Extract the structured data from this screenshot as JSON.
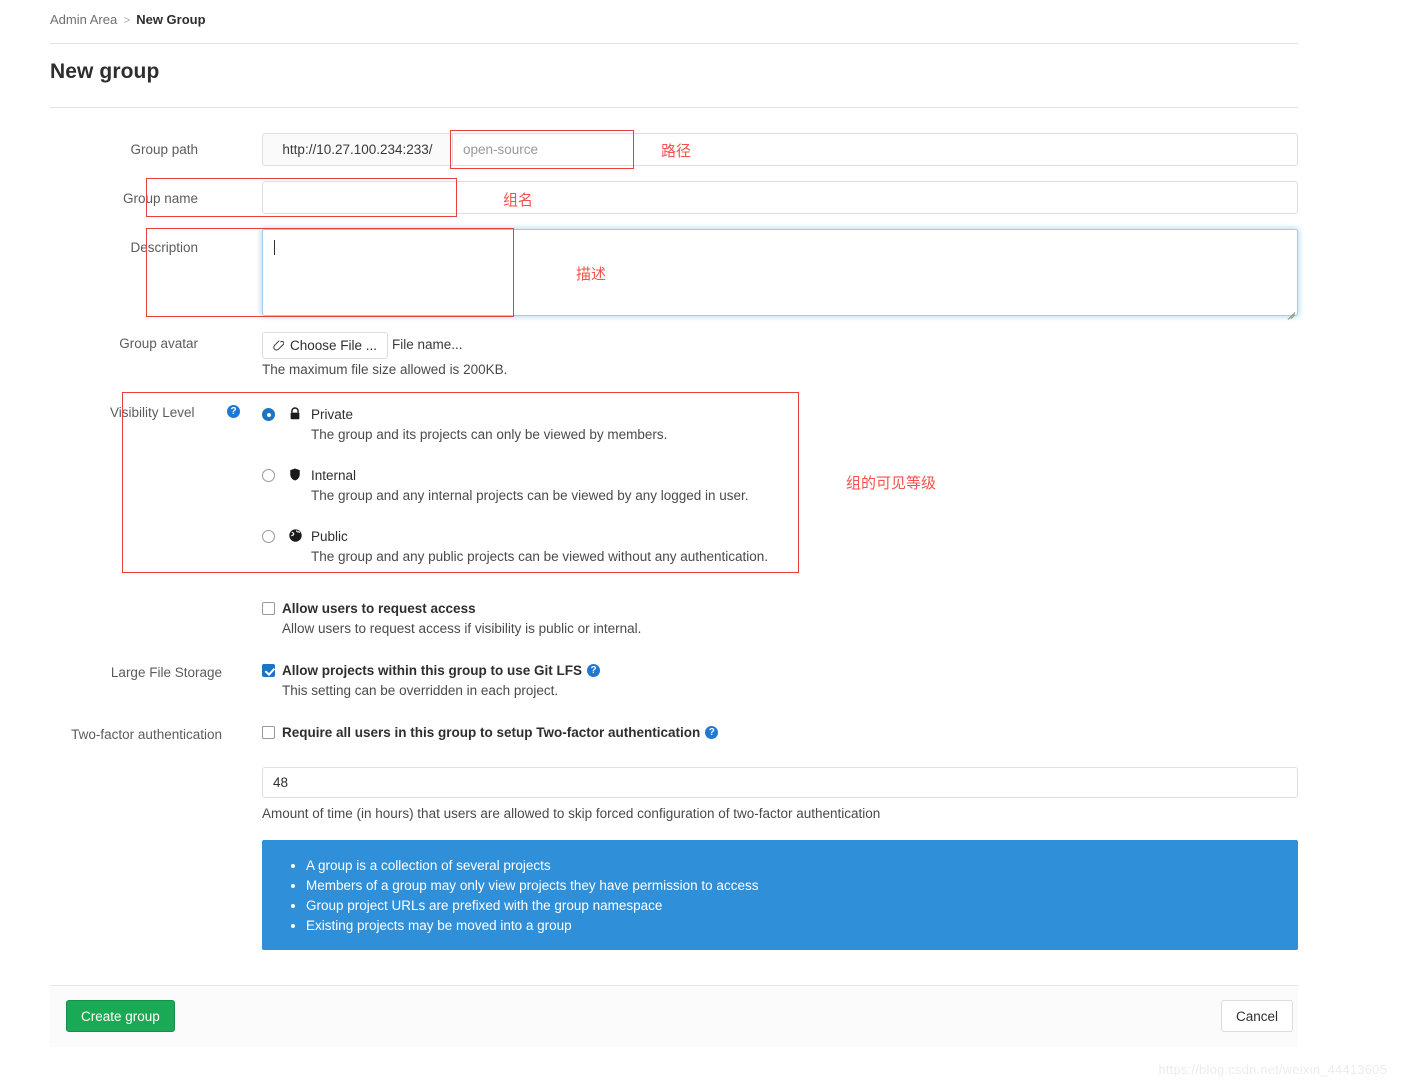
{
  "breadcrumb": {
    "parent": "Admin Area",
    "separator": ">",
    "current": "New Group"
  },
  "page": {
    "title": "New group"
  },
  "form": {
    "group_path": {
      "label": "Group path",
      "url_prefix": "http://10.27.100.234:233/",
      "placeholder": "open-source",
      "value": ""
    },
    "group_name": {
      "label": "Group name",
      "placeholder": "",
      "value": ""
    },
    "description": {
      "label": "Description",
      "placeholder": "",
      "value": ""
    },
    "group_avatar": {
      "label": "Group avatar",
      "choose_file_label": "Choose File ...",
      "file_name_text": "File name...",
      "help_text": "The maximum file size allowed is 200KB.",
      "attach_icon": "paperclip-icon"
    },
    "visibility": {
      "label": "Visibility Level",
      "help_icon": "question-help-icon",
      "selected": "Private",
      "options": [
        {
          "name": "Private",
          "icon": "lock-icon",
          "description": "The group and its projects can only be viewed by members.",
          "checked": true
        },
        {
          "name": "Internal",
          "icon": "shield-icon",
          "description": "The group and any internal projects can be viewed by any logged in user.",
          "checked": false
        },
        {
          "name": "Public",
          "icon": "globe-icon",
          "description": "The group and any public projects can be viewed without any authentication.",
          "checked": false
        }
      ]
    },
    "request_access": {
      "label": "",
      "title": "Allow users to request access",
      "description": "Allow users to request access if visibility is public or internal.",
      "checked": false
    },
    "large_file_storage": {
      "label": "Large File Storage",
      "title": "Allow projects within this group to use Git LFS",
      "description": "This setting can be overridden in each project.",
      "checked": true,
      "help_icon": "question-help-icon"
    },
    "two_factor": {
      "label": "Two-factor authentication",
      "title": "Require all users in this group to setup Two-factor authentication",
      "checked": false,
      "help_icon": "question-help-icon",
      "grace_period_value": "48",
      "grace_period_help": "Amount of time (in hours) that users are allowed to skip forced configuration of two-factor authentication"
    }
  },
  "info_panel": {
    "background_color": "#2f8fd8",
    "bullets": [
      "A group is a collection of several projects",
      "Members of a group may only view projects they have permission to access",
      "Group project URLs are prefixed with the group namespace",
      "Existing projects may be moved into a group"
    ]
  },
  "footer": {
    "create_label": "Create group",
    "create_color": "#1aaa55",
    "cancel_label": "Cancel"
  },
  "annotations": {
    "color": "#f2534c",
    "path": "路径",
    "group_name": "组名",
    "description": "描述",
    "visibility": "组的可见等级"
  },
  "watermark": {
    "text": "https://blog.csdn.net/weixin_44413605"
  }
}
